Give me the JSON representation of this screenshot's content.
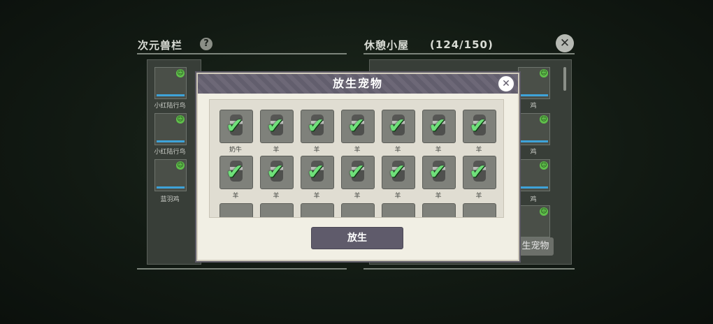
{
  "left_panel": {
    "title": "次元兽栏",
    "help_symbol": "?",
    "items": [
      {
        "label": "小红陆行鸟"
      },
      {
        "label": "小红陆行鸟"
      },
      {
        "label": "蓝羽鸡"
      }
    ]
  },
  "right_panel": {
    "title": "休憩小屋",
    "count": "(124/150)",
    "close_symbol": "✕",
    "items": [
      {
        "label": "鸡"
      },
      {
        "label": "鸡"
      },
      {
        "label": "鸡"
      }
    ],
    "release_button_partial": "生宠物"
  },
  "dialog": {
    "title": "放生宠物",
    "close_symbol": "✕",
    "check_symbol": "✔",
    "pets_row1": [
      "奶牛",
      "羊",
      "羊",
      "羊",
      "羊",
      "羊",
      "羊"
    ],
    "pets_row2": [
      "羊",
      "羊",
      "羊",
      "羊",
      "羊",
      "羊",
      "羊"
    ],
    "release_button": "放生"
  },
  "colors": {
    "check": "#6fe07a",
    "dialog_header": "#6d6877",
    "button": "#5f5b6b",
    "happy_face": "#5fbf4a",
    "bar": "#3ea3d9"
  }
}
